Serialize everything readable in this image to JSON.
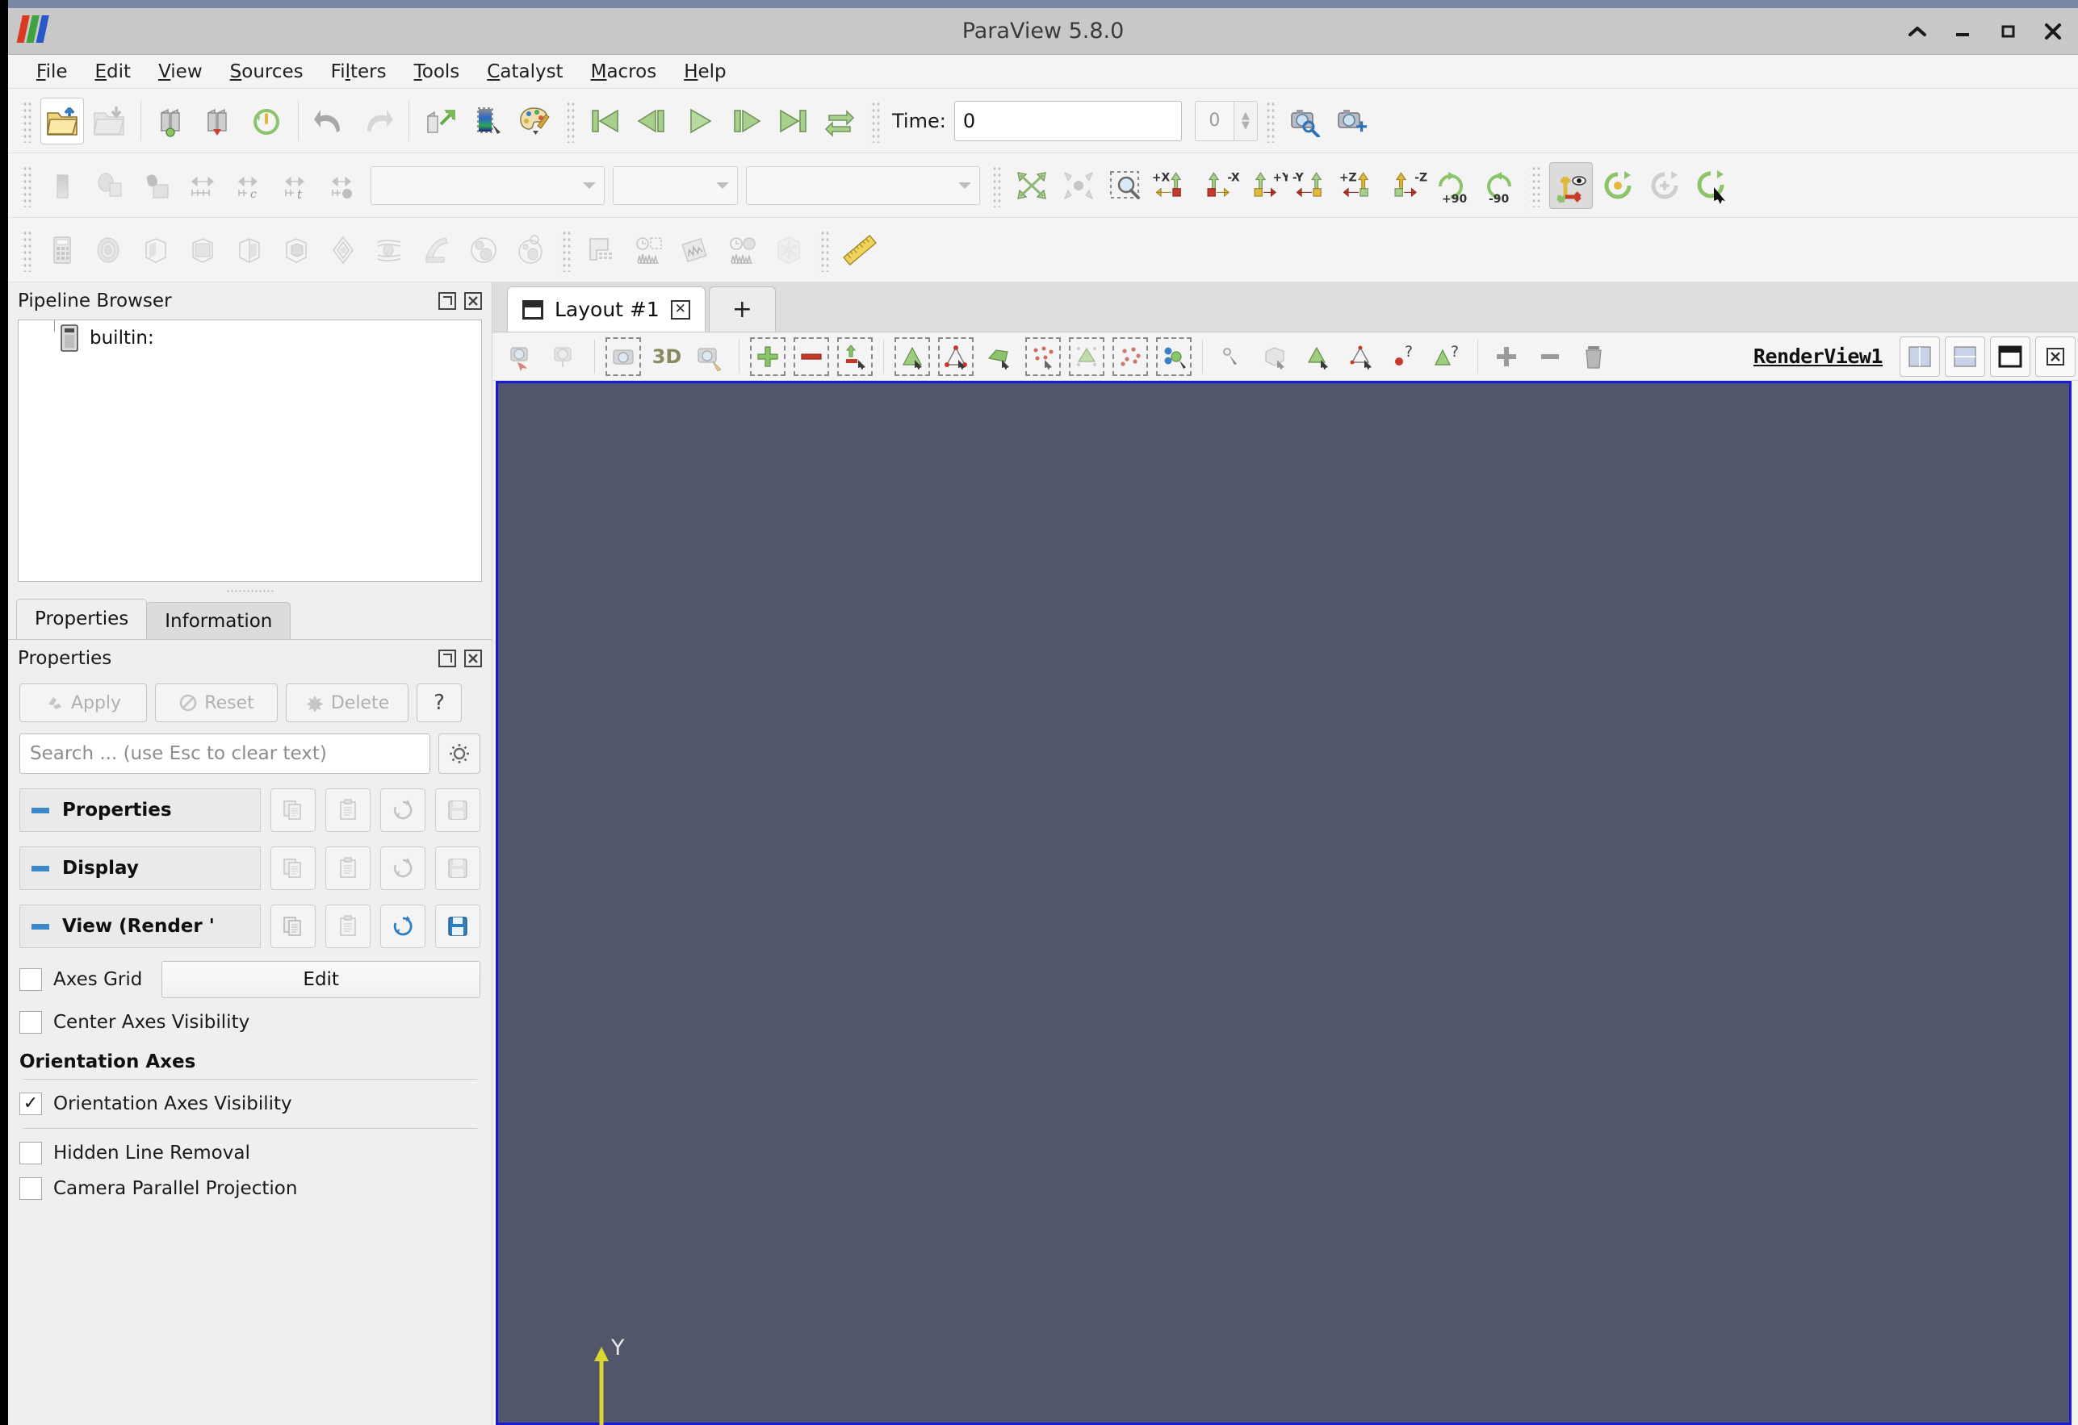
{
  "window": {
    "title": "ParaView 5.8.0",
    "logo_name": "paraview-logo",
    "buttons": {
      "shade": "^",
      "minimize": "–",
      "maximize": "□",
      "close": "✕"
    }
  },
  "menubar": {
    "items": [
      {
        "label": "File",
        "accel": "F"
      },
      {
        "label": "Edit",
        "accel": "E"
      },
      {
        "label": "View",
        "accel": "V"
      },
      {
        "label": "Sources",
        "accel": "S"
      },
      {
        "label": "Filters",
        "accel": "l"
      },
      {
        "label": "Tools",
        "accel": "T"
      },
      {
        "label": "Catalyst",
        "accel": "C"
      },
      {
        "label": "Macros",
        "accel": "M"
      },
      {
        "label": "Help",
        "accel": "H"
      }
    ]
  },
  "toolbar_main": {
    "buttons": [
      {
        "name": "open-file",
        "state": "active"
      },
      {
        "name": "save-data",
        "state": "disabled"
      },
      {
        "name": "connect-server",
        "state": "normal"
      },
      {
        "name": "disconnect-server",
        "state": "normal"
      },
      {
        "name": "reset-session",
        "state": "normal"
      },
      {
        "name": "undo",
        "state": "normal"
      },
      {
        "name": "redo",
        "state": "disabled"
      },
      {
        "name": "change-data-directory",
        "state": "normal"
      },
      {
        "name": "edit-color-map",
        "state": "normal"
      },
      {
        "name": "color-palette",
        "state": "normal"
      }
    ],
    "vcr": [
      {
        "name": "first-frame"
      },
      {
        "name": "previous-frame"
      },
      {
        "name": "play"
      },
      {
        "name": "next-frame"
      },
      {
        "name": "last-frame"
      },
      {
        "name": "loop"
      }
    ],
    "time_label": "Time:",
    "time_value": "0",
    "frame_value": "0",
    "camera_buttons": [
      {
        "name": "adjust-camera"
      },
      {
        "name": "add-camera-link"
      }
    ]
  },
  "toolbar_repr": {
    "buttons": [
      {
        "name": "solid-color-representation"
      },
      {
        "name": "surface-representation"
      },
      {
        "name": "rescale-to-data-range"
      },
      {
        "name": "rescale-to-custom-range"
      },
      {
        "name": "rescale-to-data-range-over-time"
      },
      {
        "name": "rescale-to-visible-range"
      },
      {
        "name": "rescale-to-temporal-range"
      }
    ],
    "combos": [
      {
        "name": "array-selector",
        "value": ""
      },
      {
        "name": "component-selector",
        "value": ""
      },
      {
        "name": "representation-selector",
        "value": ""
      }
    ],
    "camera_controls": [
      {
        "name": "reset-camera"
      },
      {
        "name": "zoom-to-data"
      },
      {
        "name": "zoom-to-box"
      },
      {
        "name": "set-view-direction-plus-x",
        "label": "+X"
      },
      {
        "name": "set-view-direction-minus-x",
        "label": "-X"
      },
      {
        "name": "set-view-direction-plus-y",
        "label": "+Y"
      },
      {
        "name": "set-view-direction-minus-y",
        "label": "-Y"
      },
      {
        "name": "set-view-direction-plus-z",
        "label": "+Z"
      },
      {
        "name": "set-view-direction-minus-z",
        "label": "-Z"
      },
      {
        "name": "rotate-90-clockwise",
        "label": "+90"
      },
      {
        "name": "rotate-90-counterclockwise",
        "label": "-90"
      }
    ],
    "center_axes": [
      {
        "name": "show-center-axes",
        "state": "pressed"
      },
      {
        "name": "reset-center-of-rotation"
      },
      {
        "name": "pick-center-of-rotation"
      },
      {
        "name": "reset-camera-closeup"
      }
    ]
  },
  "toolbar_filters": {
    "buttons": [
      {
        "name": "calculator-filter"
      },
      {
        "name": "contour-filter"
      },
      {
        "name": "clip-filter"
      },
      {
        "name": "slice-filter"
      },
      {
        "name": "threshold-filter"
      },
      {
        "name": "extract-subset-filter"
      },
      {
        "name": "glyph-filter"
      },
      {
        "name": "stream-tracer-filter"
      },
      {
        "name": "warp-by-vector-filter"
      },
      {
        "name": "group-datasets-filter"
      },
      {
        "name": "extract-level-filter"
      },
      {
        "name": "spreadsheet-view"
      },
      {
        "name": "plot-over-time"
      },
      {
        "name": "plot-data"
      },
      {
        "name": "plot-selection-over-time"
      },
      {
        "name": "extract-selection"
      },
      {
        "name": "measurement-ruler"
      }
    ]
  },
  "pipeline_browser": {
    "title": "Pipeline Browser",
    "dock_buttons": [
      {
        "name": "undock-pipeline-browser",
        "glyph": "❐"
      },
      {
        "name": "close-pipeline-browser",
        "glyph": "⌧"
      }
    ],
    "items": [
      {
        "label": "builtin:",
        "icon": "server-icon"
      }
    ]
  },
  "properties_panel": {
    "tabs": [
      {
        "label": "Properties",
        "selected": true
      },
      {
        "label": "Information",
        "selected": false
      }
    ],
    "title": "Properties",
    "dock_buttons": [
      {
        "name": "undock-properties",
        "glyph": "❐"
      },
      {
        "name": "close-properties",
        "glyph": "⌧"
      }
    ],
    "action_buttons": [
      {
        "name": "apply-button",
        "label": "Apply",
        "enabled": false
      },
      {
        "name": "reset-button",
        "label": "Reset",
        "enabled": false
      },
      {
        "name": "delete-button",
        "label": "Delete",
        "enabled": false
      },
      {
        "name": "help-button",
        "label": "?",
        "enabled": true
      }
    ],
    "search_placeholder": "Search ... (use Esc to clear text)",
    "search_value": "",
    "gear_button": "toggle-advanced-properties",
    "groups": [
      {
        "name": "properties-group",
        "label": "Properties",
        "enabled_save": false
      },
      {
        "name": "display-group",
        "label": "Display",
        "enabled_save": false
      },
      {
        "name": "view-group",
        "label": "View (Render '",
        "enabled_save": true
      }
    ],
    "group_buttons": [
      {
        "name": "copy-properties-button"
      },
      {
        "name": "paste-properties-button"
      },
      {
        "name": "restore-defaults-button"
      },
      {
        "name": "save-as-defaults-button"
      }
    ],
    "options": [
      {
        "name": "axes-grid-checkbox",
        "label": "Axes Grid",
        "checked": false,
        "has_edit": true,
        "edit_label": "Edit"
      },
      {
        "name": "center-axes-visibility-checkbox",
        "label": "Center Axes Visibility",
        "checked": false,
        "has_edit": false
      },
      {
        "name": "orientation-axes-visibility-checkbox",
        "label": "Orientation Axes Visibility",
        "checked": true,
        "has_edit": false
      },
      {
        "name": "hidden-line-removal-checkbox",
        "label": "Hidden Line Removal",
        "checked": false,
        "has_edit": false
      },
      {
        "name": "camera-parallel-projection-checkbox",
        "label": "Camera Parallel Projection",
        "checked": false,
        "has_edit": false
      }
    ],
    "section_heading": "Orientation Axes"
  },
  "layout": {
    "tabs": [
      {
        "label": "Layout #1",
        "closable": true,
        "selected": true
      }
    ],
    "add_tab_label": "+"
  },
  "view_toolbar": {
    "left_buttons": [
      {
        "name": "interactive-select-cells-on"
      },
      {
        "name": "interactive-select-points-on"
      },
      {
        "name": "select-cells-through"
      },
      {
        "name": "toggle-3d-2d",
        "label": "3D"
      },
      {
        "name": "zoom-to-box-view"
      },
      {
        "name": "add-selection"
      },
      {
        "name": "subtract-selection"
      },
      {
        "name": "toggle-selection"
      },
      {
        "name": "select-cells-with-polygon"
      },
      {
        "name": "select-points-with-polygon"
      },
      {
        "name": "select-surface-cells"
      },
      {
        "name": "select-surface-points"
      },
      {
        "name": "select-frustum-cells"
      },
      {
        "name": "select-frustum-points"
      },
      {
        "name": "select-blocks"
      },
      {
        "name": "interactive-select-points"
      },
      {
        "name": "hover-cells-on"
      },
      {
        "name": "hover-points-on"
      },
      {
        "name": "find-data-cells"
      },
      {
        "name": "find-data-points"
      },
      {
        "name": "plot-selection"
      },
      {
        "name": "remove-selection"
      },
      {
        "name": "clear-selection"
      }
    ],
    "view_name": "RenderView1",
    "corner_buttons": [
      {
        "name": "split-horizontal"
      },
      {
        "name": "split-vertical"
      },
      {
        "name": "maximize-view"
      },
      {
        "name": "close-view"
      }
    ]
  },
  "render_view": {
    "name": "render-view-canvas",
    "background_color": "#52566b",
    "border_color": "#1b1bd6",
    "orientation_axes": {
      "visible": true,
      "y_label": "Y",
      "y_color": "#d8d830"
    }
  }
}
